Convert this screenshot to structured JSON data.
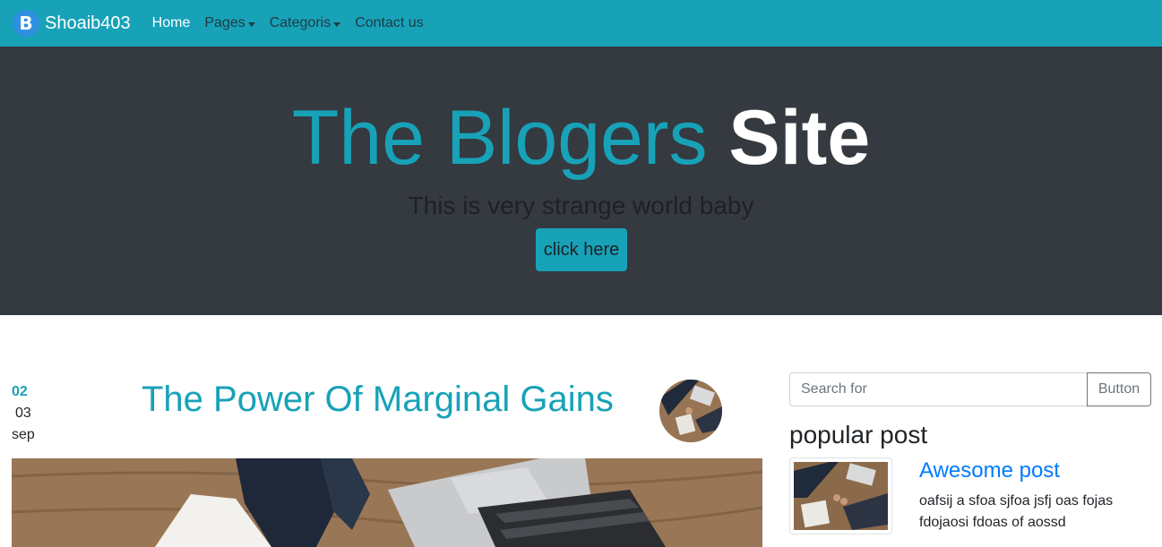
{
  "nav": {
    "brand_letter": "B",
    "brand_name": "Shoaib403",
    "links": [
      "Home",
      "Pages",
      "Categoris",
      "Contact us"
    ]
  },
  "hero": {
    "title_part1": "The Blogers",
    "title_part2": "Site",
    "subtitle": "This is very strange world baby",
    "button_label": "click here"
  },
  "post": {
    "date_line1": "02",
    "date_line2": "03",
    "date_line3": "sep",
    "title": "The Power Of Marginal Gains"
  },
  "sidebar": {
    "search_placeholder": "Search for",
    "search_button": "Button",
    "popular_heading": "popular post",
    "popular_post_title": "Awesome post",
    "popular_post_text": "oafsij a sfoa sjfoa jsfj oas fojas fdojaosi fdoas of aossd"
  },
  "colors": {
    "navbar": "#17a2b8",
    "hero_bg": "#343a40",
    "accent": "#17a2b8",
    "link": "#007bff"
  }
}
